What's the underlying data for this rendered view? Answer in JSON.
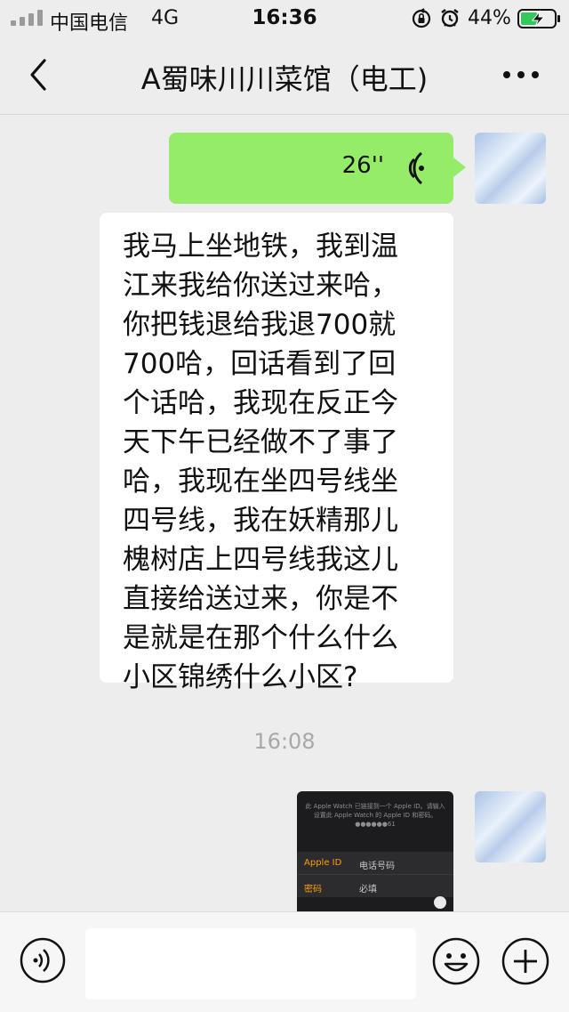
{
  "status_bar": {
    "carrier": "中国电信",
    "network": "4G",
    "time": "16:36",
    "battery": "44%",
    "icons": [
      "signal-icon",
      "orientation-lock-icon",
      "alarm-icon",
      "battery-charging-icon"
    ]
  },
  "nav": {
    "title": "A蜀味川川菜馆（电工)",
    "back_icon": "chevron-left-icon",
    "more_icon": "more-dots-icon"
  },
  "messages": {
    "voice": {
      "duration": "26''",
      "icon": "voice-playing-icon"
    },
    "text": {
      "lines": [
        "我马上坐地铁，我到温",
        "江来我给你送过来哈，",
        "你把钱退给我退700就",
        "700哈，回话看到了回",
        "个话哈，我现在反正今",
        "天下午已经做不了事了",
        "哈，我现在坐四号线坐",
        "四号线，我在妖精那儿",
        "槐树店上四号线我这儿",
        "直接给送过来，你是不",
        "是就是在那个什么什么",
        "小区锦绣什么小区?"
      ]
    },
    "timestamp": "16:08",
    "image": {
      "note": "此 Apple Watch 已链接到一个 Apple ID。请输入设置此 Apple Watch 的 Apple ID 和密码。●●●●●●61",
      "row1_label": "Apple ID",
      "row1_value": "电话号码",
      "row2_label": "密码",
      "row2_value": "必填"
    }
  },
  "input_bar": {
    "placeholder": "",
    "icons": [
      "voice-input-icon",
      "emoji-icon",
      "plus-icon"
    ]
  },
  "colors": {
    "background": "#ededed",
    "sent_bubble": "#95ec69",
    "received_bubble": "#ffffff",
    "timestamp": "#a8a8a8",
    "battery_fill": "#34c759"
  }
}
